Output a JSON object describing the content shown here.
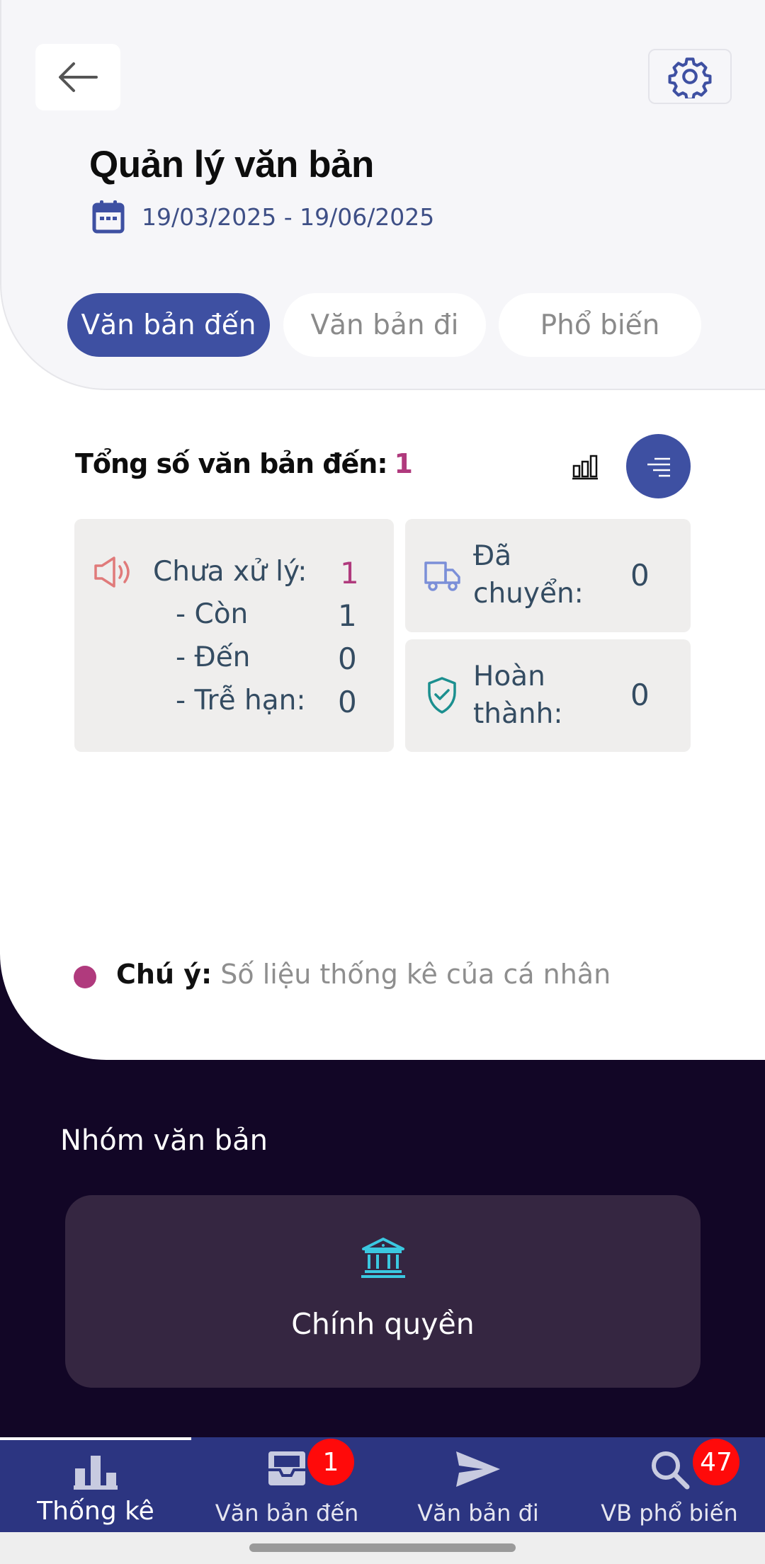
{
  "header": {
    "title": "Quản lý văn bản",
    "date_range": "19/03/2025 - 19/06/2025"
  },
  "tabs": [
    {
      "label": "Văn bản đến",
      "active": true
    },
    {
      "label": "Văn bản đi",
      "active": false
    },
    {
      "label": "Phổ biến",
      "active": false
    }
  ],
  "summary": {
    "total_label": "Tổng số văn bản đến:",
    "total_value": "1"
  },
  "cards": {
    "pending": {
      "label": "Chưa xử lý:",
      "value": "1",
      "rows": [
        {
          "label": "- Còn",
          "value": "1"
        },
        {
          "label": "- Đến",
          "value": "0"
        },
        {
          "label": "- Trễ hạn:",
          "value": "0"
        }
      ]
    },
    "transferred": {
      "label_line1": "Đã",
      "label_line2": "chuyển:",
      "value": "0"
    },
    "completed": {
      "label_line1": "Hoàn",
      "label_line2": "thành:",
      "value": "0"
    }
  },
  "note": {
    "label": "Chú ý:",
    "text": " Số liệu thống kê của cá nhân"
  },
  "group": {
    "title": "Nhóm văn bản",
    "card_label": "Chính quyền"
  },
  "bottom_nav": [
    {
      "label": "Thống kê",
      "icon": "bar-chart-icon",
      "active": true
    },
    {
      "label": "Văn bản đến",
      "icon": "inbox-icon",
      "badge": "1"
    },
    {
      "label": "Văn bản đi",
      "icon": "send-icon"
    },
    {
      "label": "VB phổ biến",
      "icon": "search-icon",
      "badge": "47"
    }
  ],
  "colors": {
    "primary": "#3e50a2",
    "accent": "#b03a7d",
    "dark_bg": "#120626",
    "nav_bg": "#2c3581",
    "badge": "#ff0a0a"
  }
}
